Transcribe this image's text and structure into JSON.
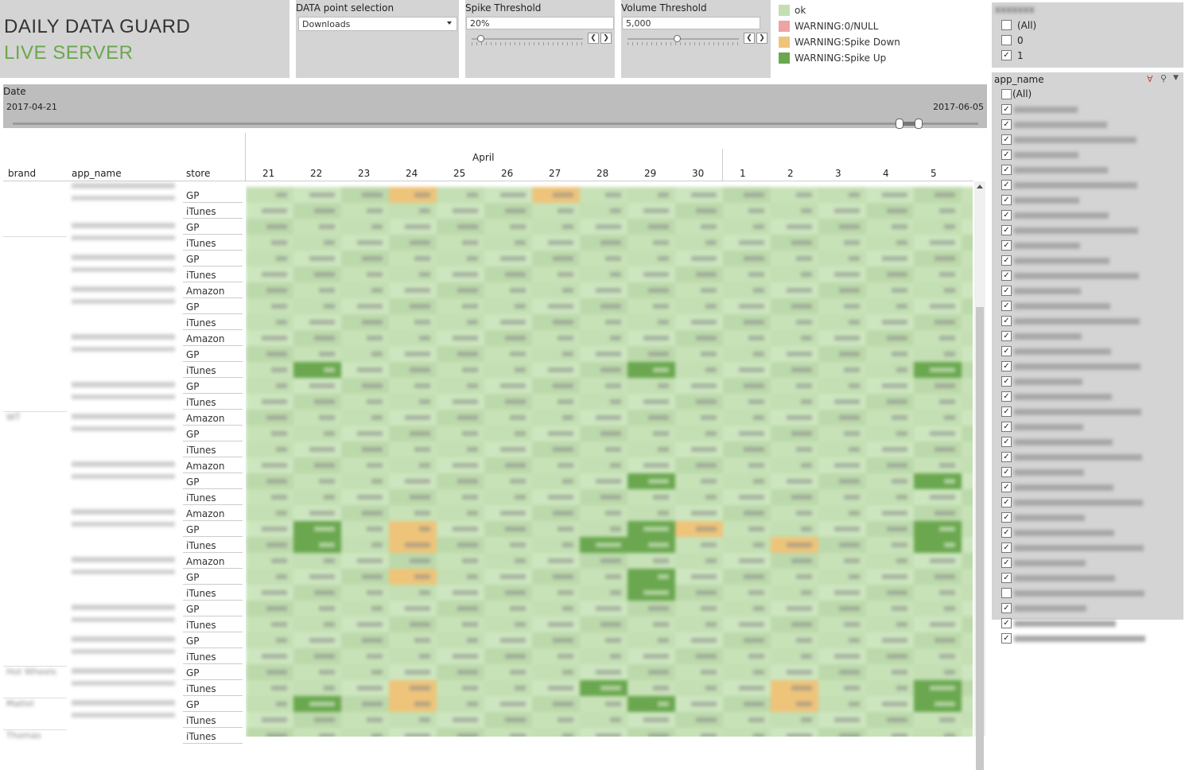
{
  "header": {
    "title_line1": "DAILY DATA GUARD",
    "title_line2": "LIVE SERVER"
  },
  "data_point_selection": {
    "label": "DATA point selection",
    "value": "Downloads"
  },
  "spike_threshold": {
    "label": "Spike Threshold",
    "value": "20%",
    "slider_level": 0.08
  },
  "volume_threshold": {
    "label": "Volume Threshold",
    "value": "5,000",
    "slider_level": 0.44
  },
  "legend": [
    {
      "label": "ok",
      "color": "#c3dfb3"
    },
    {
      "label": "WARNING:0/NULL",
      "color": "#eea3a5"
    },
    {
      "label": "WARNING:Spike Down",
      "color": "#eec47a"
    },
    {
      "label": "WARNING:Spike Up",
      "color": "#6aa74f"
    }
  ],
  "filter1": {
    "items": [
      {
        "label": "(All)",
        "checked": false
      },
      {
        "label": "0",
        "checked": false
      },
      {
        "label": "1",
        "checked": true
      }
    ]
  },
  "date_filter": {
    "label": "Date",
    "start": "2017-04-21",
    "end": "2017-06-05"
  },
  "table": {
    "col_headers": {
      "brand": "brand",
      "app_name": "app_name",
      "store": "store"
    },
    "month_label": "April",
    "days": [
      "21",
      "22",
      "23",
      "24",
      "25",
      "26",
      "27",
      "28",
      "29",
      "30",
      "1",
      "2",
      "3",
      "4",
      "5"
    ],
    "stores": [
      "GP",
      "iTunes",
      "GP",
      "iTunes",
      "GP",
      "iTunes",
      "Amazon",
      "GP",
      "iTunes",
      "Amazon",
      "GP",
      "iTunes",
      "GP",
      "iTunes",
      "Amazon",
      "GP",
      "iTunes",
      "Amazon",
      "GP",
      "iTunes",
      "Amazon",
      "GP",
      "iTunes",
      "Amazon",
      "GP",
      "iTunes",
      "GP",
      "iTunes",
      "GP",
      "iTunes",
      "GP",
      "iTunes",
      "GP",
      "iTunes",
      "iTunes"
    ]
  },
  "app_filter": {
    "label": "app_name",
    "all_label": "(All)",
    "checked": [
      true,
      true,
      true,
      true,
      true,
      true,
      true,
      true,
      true,
      true,
      true,
      true,
      true,
      true,
      true,
      true,
      true,
      true,
      true,
      true,
      true,
      true,
      true,
      true,
      true,
      true,
      true,
      true,
      true,
      true,
      true,
      true,
      false,
      true,
      true,
      true
    ]
  },
  "icons": {
    "clear_filter": "clear-filter-icon",
    "search": "search-icon",
    "menu": "dropdown-menu-icon"
  }
}
